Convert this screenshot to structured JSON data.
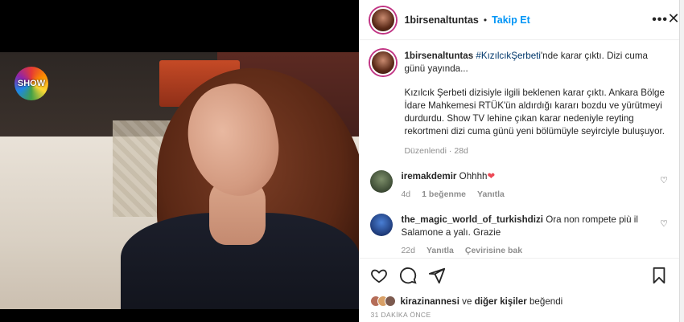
{
  "post": {
    "username": "1birsenaltuntas",
    "follow_label": "Takip Et",
    "media_logo_text": "SHOW"
  },
  "caption": {
    "username": "1birsenaltuntas",
    "hashtag": "#KızılcıkŞerbeti",
    "line1_rest": "'nde karar çıktı. Dizi cuma günü yayında...",
    "paragraph2": "Kızılcık Şerbeti dizisiyle ilgili beklenen karar çıktı. Ankara Bölge İdare Mahkemesi RTÜK'ün aldırdığı kararı bozdu ve yürütmeyi durdurdu. Show TV lehine çıkan karar nedeniyle reyting rekortmeni dizi cuma günü yeni bölümüyle seyirciyle buluşuyor.",
    "edited": "Düzenlendi",
    "age": "28d"
  },
  "comments": [
    {
      "username": "iremakdemir",
      "text": "Ohhhh",
      "age": "4d",
      "likes": "1 beğenme",
      "reply": "Yanıtla",
      "translate": ""
    },
    {
      "username": "the_magic_world_of_turkishdizi",
      "text": "Ora non rompete più il Salamone a yalı. Grazie",
      "age": "22d",
      "likes": "",
      "reply": "Yanıtla",
      "translate": "Çevirisine bak"
    }
  ],
  "likes": {
    "first_liker": "kirazinannesi",
    "connector": "ve",
    "others": "diğer kişiler",
    "verb": "beğendi"
  },
  "timestamp": "31 DAKİKA ÖNCE",
  "icons": {
    "like": "heart-icon",
    "comment": "comment-icon",
    "share": "share-icon",
    "save": "bookmark-icon",
    "more": "more-icon"
  }
}
